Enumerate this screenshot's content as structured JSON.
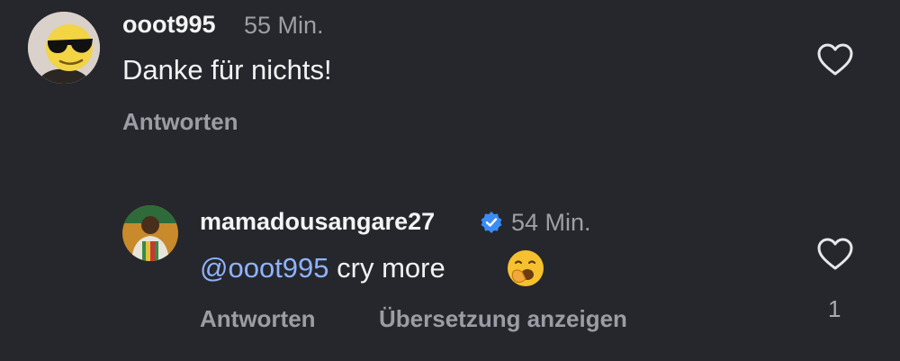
{
  "comments": [
    {
      "username": "ooot995",
      "time": "55 Min.",
      "text": "Danke für nichts!",
      "reply_label": "Antworten",
      "avatar_icon": "sunglasses-emoji-avatar",
      "like_icon": "heart-outline-icon"
    },
    {
      "username": "mamadousangare27",
      "verified": true,
      "time": "54 Min.",
      "mention": "@ooot995",
      "text": " cry more",
      "emoji": "yawning-face-emoji",
      "reply_label": "Antworten",
      "translate_label": "Übersetzung anzeigen",
      "like_count": "1",
      "avatar_icon": "player-photo-avatar",
      "like_icon": "heart-outline-icon"
    }
  ],
  "colors": {
    "background": "#25272c",
    "mention": "#8fb3ff",
    "verified": "#3b8cf6",
    "muted": "#9a9da4"
  }
}
